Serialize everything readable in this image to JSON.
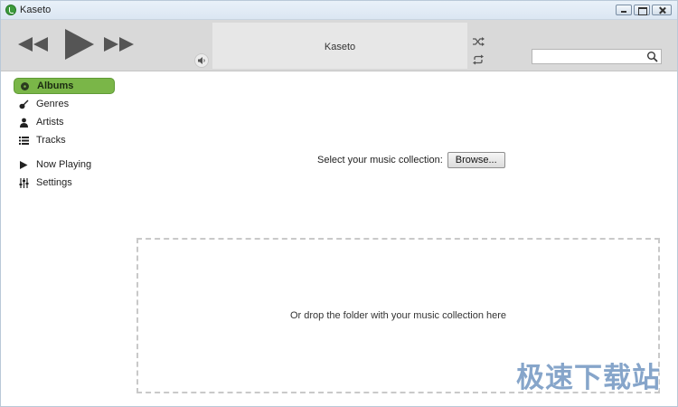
{
  "window": {
    "title": "Kaseto",
    "controls": [
      "minimize",
      "maximize",
      "close"
    ]
  },
  "toolbar": {
    "now_playing_title": "Kaseto",
    "search": {
      "value": "",
      "placeholder": ""
    },
    "icons": [
      "previous-icon",
      "play-icon",
      "next-icon",
      "volume-icon",
      "shuffle-icon",
      "repeat-icon",
      "search-icon"
    ]
  },
  "sidebar": {
    "items": [
      {
        "label": "Albums",
        "icon": "album-icon",
        "active": true
      },
      {
        "label": "Genres",
        "icon": "guitar-icon",
        "active": false
      },
      {
        "label": "Artists",
        "icon": "person-icon",
        "active": false
      },
      {
        "label": "Tracks",
        "icon": "list-icon",
        "active": false
      },
      {
        "label": "Now Playing",
        "icon": "play-small-icon",
        "active": false
      },
      {
        "label": "Settings",
        "icon": "sliders-icon",
        "active": false
      }
    ]
  },
  "main": {
    "select_label": "Select your music collection:",
    "browse_label": "Browse...",
    "drop_text": "Or drop the folder with your music collection here"
  },
  "watermark": {
    "text": "极速下载站"
  },
  "colors": {
    "accent": "#7ab648",
    "toolbar_bg": "#d9d9d9",
    "panel_bg": "#e7e7e7",
    "titlebar_bg": "#dbe6f2"
  }
}
